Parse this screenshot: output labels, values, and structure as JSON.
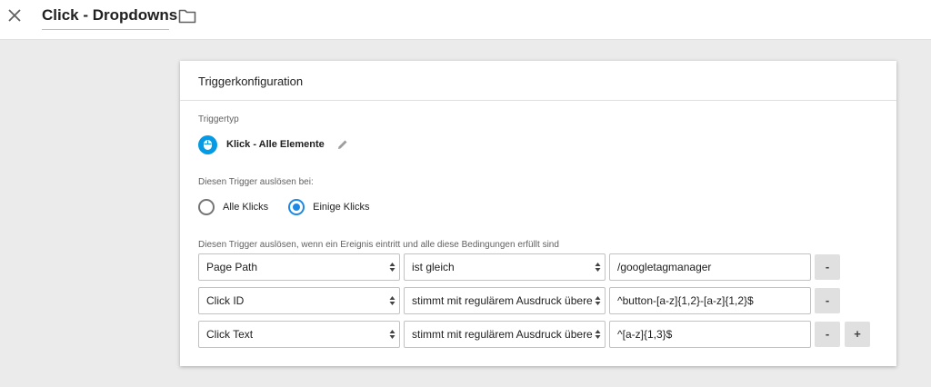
{
  "header": {
    "title": "Click - Dropdowns",
    "close_icon": "close-icon",
    "folder_icon": "folder-icon"
  },
  "card": {
    "title": "Triggerkonfiguration",
    "trigger_type_label": "Triggertyp",
    "trigger_type": {
      "name": "Klick - Alle Elemente",
      "icon": "mouse-icon",
      "icon_color": "#039be5"
    },
    "fire_on_label": "Diesen Trigger auslösen bei:",
    "fire_on_options": [
      {
        "label": "Alle Klicks",
        "checked": false
      },
      {
        "label": "Einige Klicks",
        "checked": true
      }
    ],
    "conditions_label": "Diesen Trigger auslösen, wenn ein Ereignis eintritt und alle diese Bedingungen erfüllt sind",
    "conditions": [
      {
        "variable": "Page Path",
        "operator": "ist gleich",
        "value": "/googletagmanager",
        "remove": "-"
      },
      {
        "variable": "Click ID",
        "operator": "stimmt mit regulärem Ausdruck übere",
        "value": "^button-[a-z]{1,2}-[a-z]{1,2}$",
        "remove": "-"
      },
      {
        "variable": "Click Text",
        "operator": "stimmt mit regulärem Ausdruck übere",
        "value": "^[a-z]{1,3}$",
        "remove": "-",
        "add": "+"
      }
    ]
  },
  "colors": {
    "accent": "#1e88e5",
    "background": "#ebebeb",
    "card": "#ffffff"
  }
}
